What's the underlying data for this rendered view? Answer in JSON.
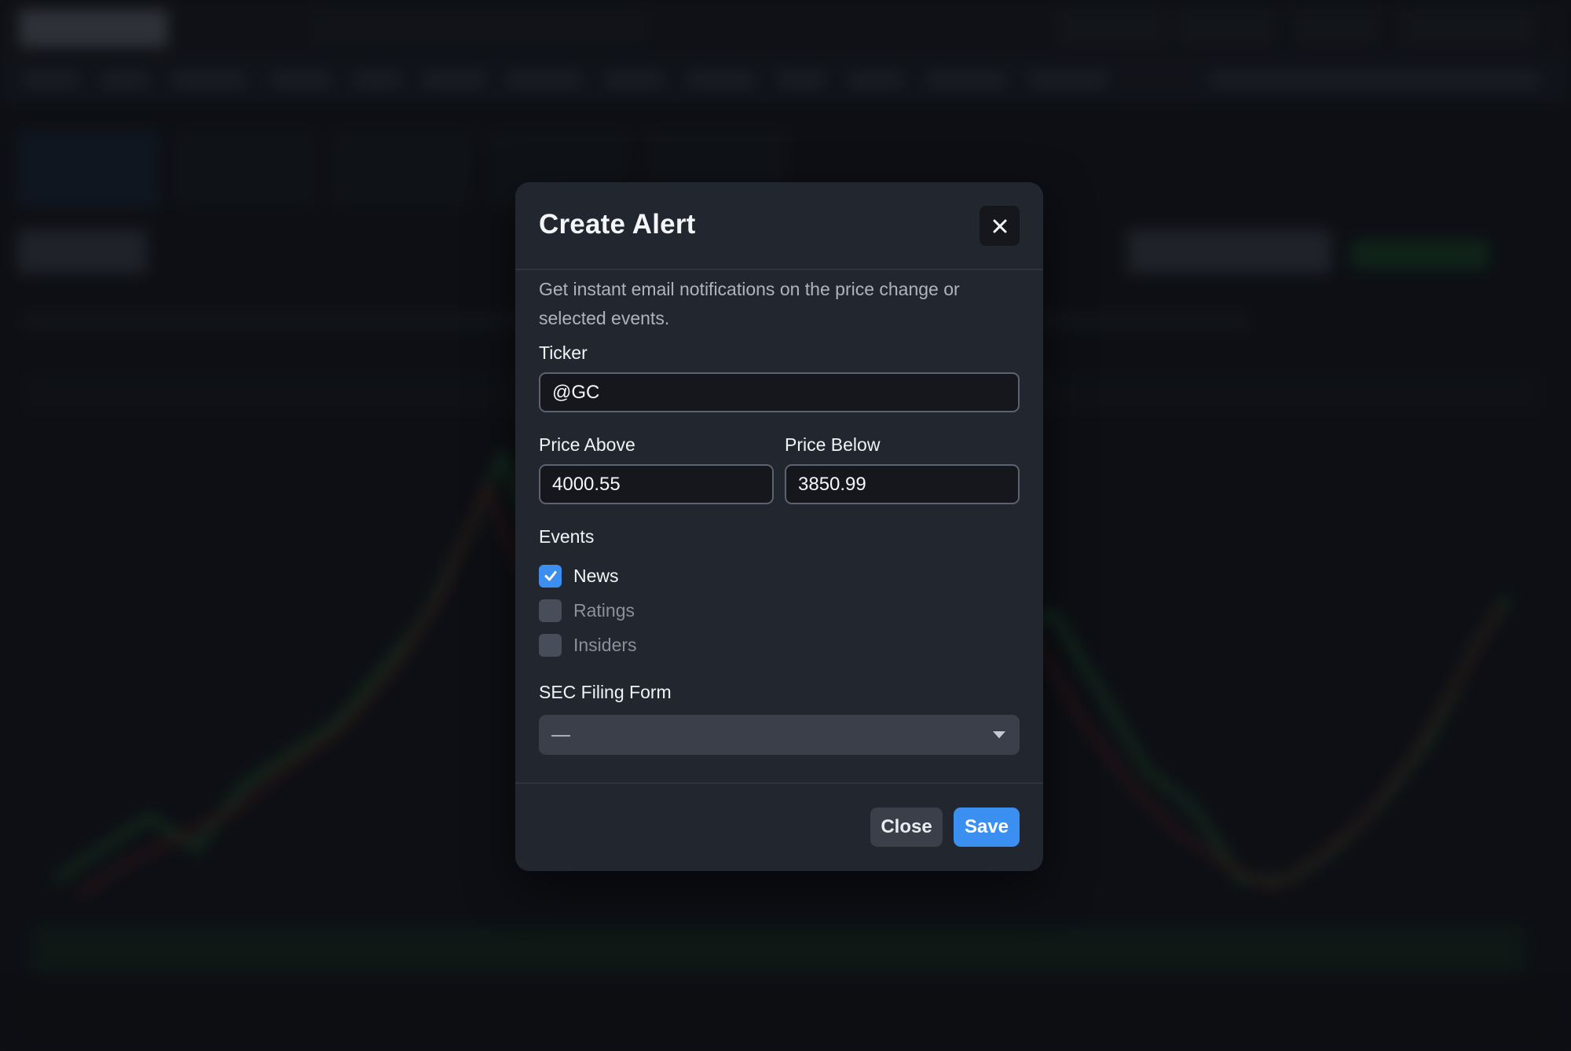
{
  "modal": {
    "title": "Create Alert",
    "description": "Get instant email notifications on the price change or selected events.",
    "close_icon": "close-icon",
    "ticker": {
      "label": "Ticker",
      "value": "@GC"
    },
    "price_above": {
      "label": "Price Above",
      "value": "4000.55"
    },
    "price_below": {
      "label": "Price Below",
      "value": "3850.99"
    },
    "events": {
      "label": "Events",
      "items": [
        {
          "label": "News",
          "checked": true
        },
        {
          "label": "Ratings",
          "checked": false
        },
        {
          "label": "Insiders",
          "checked": false
        }
      ]
    },
    "sec_filing": {
      "label": "SEC Filing Form",
      "selected": "—"
    },
    "buttons": {
      "close": "Close",
      "save": "Save"
    },
    "colors": {
      "accent": "#3b8ff0",
      "modal_bg": "#22262e",
      "field_bg": "#15171c"
    }
  }
}
